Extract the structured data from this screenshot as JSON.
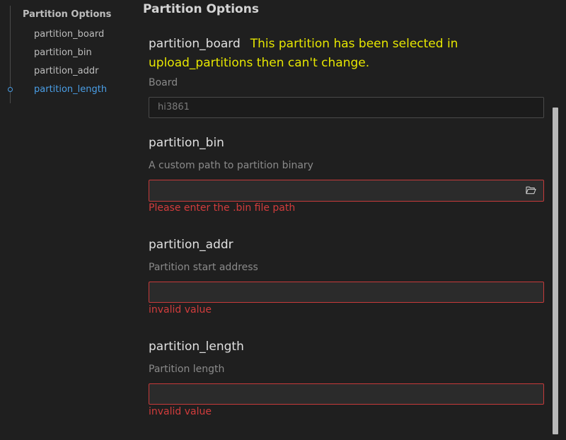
{
  "sidebar": {
    "title": "Partition Options",
    "items": [
      {
        "label": "partition_board",
        "active": false
      },
      {
        "label": "partition_bin",
        "active": false
      },
      {
        "label": "partition_addr",
        "active": false
      },
      {
        "label": "partition_length",
        "active": true
      }
    ]
  },
  "main": {
    "section_title": "Partition Options",
    "partition_board": {
      "title": "partition_board",
      "warning": "This partition has been selected in upload_partitions then can't change.",
      "description": "Board",
      "value": "hi3861"
    },
    "partition_bin": {
      "title": "partition_bin",
      "description": "A custom path to partition binary",
      "value": "",
      "error": "Please enter the .bin file path",
      "icon": "folder-open-icon"
    },
    "partition_addr": {
      "title": "partition_addr",
      "description": "Partition start address",
      "value": "",
      "error": "invalid value"
    },
    "partition_length": {
      "title": "partition_length",
      "description": "Partition length",
      "value": "",
      "error": "invalid value"
    }
  },
  "colors": {
    "background": "#1f1f1f",
    "accent": "#4a9ee6",
    "warning": "#e6e600",
    "error": "#d13c3c",
    "error_border": "#c63a3a"
  }
}
